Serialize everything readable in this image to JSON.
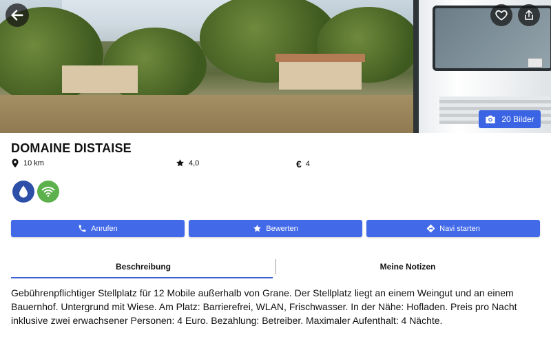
{
  "hero": {
    "photo_count_label": "20 Bilder"
  },
  "place": {
    "name": "DOMAINE DISTAISE",
    "distance": "10 km",
    "rating": "4,0",
    "price": "4"
  },
  "services": [
    {
      "name": "water",
      "color": "#2d4fa8"
    },
    {
      "name": "wifi",
      "color": "#5cb14c"
    }
  ],
  "actions": {
    "call_label": "Anrufen",
    "rate_label": "Bewerten",
    "navigate_label": "Navi starten"
  },
  "tabs": {
    "description_label": "Beschreibung",
    "notes_label": "Meine Notizen"
  },
  "description": "Gebührenpflichtiger Stellplatz  für 12 Mobile außerhalb von Grane. Der Stellplatz liegt an einem Weingut und an einem Bauernhof. Untergrund mit Wiese. Am Platz: Barrierefrei, WLAN, Frischwasser. In der Nähe: Hofladen. Preis pro Nacht inklusive zwei erwachsener Personen: 4 Euro. Bezahlung: Betreiber. Maximaler Aufenthalt: 4 Nächte.",
  "colors": {
    "accent": "#4169e8",
    "tab_underline": "#3b5fd9"
  }
}
